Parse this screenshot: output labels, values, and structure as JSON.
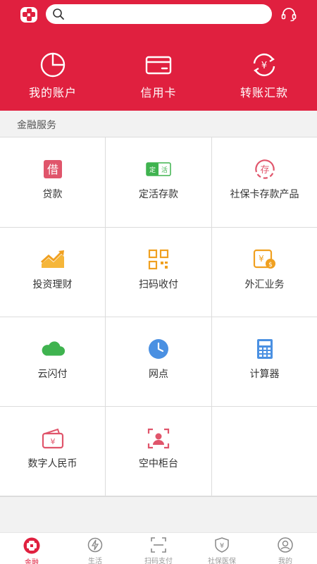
{
  "header": {
    "logo": "bank-logo-icon",
    "search": {
      "placeholder": "",
      "value": ""
    },
    "support_icon": "headset-icon",
    "quick_actions": [
      {
        "label": "我的账户",
        "icon": "pie-chart-icon"
      },
      {
        "label": "信用卡",
        "icon": "credit-card-icon"
      },
      {
        "label": "转账汇款",
        "icon": "transfer-yuan-icon"
      }
    ]
  },
  "section": {
    "title": "金融服务"
  },
  "services": [
    {
      "label": "贷款",
      "icon": "loan-icon",
      "badge": "借"
    },
    {
      "label": "定活存款",
      "icon": "deposit-icon",
      "badge": "定活"
    },
    {
      "label": "社保卡存款产品",
      "icon": "social-card-deposit-icon",
      "badge": "存"
    },
    {
      "label": "投资理财",
      "icon": "investment-icon"
    },
    {
      "label": "扫码收付",
      "icon": "qr-code-icon"
    },
    {
      "label": "外汇业务",
      "icon": "forex-icon"
    },
    {
      "label": "云闪付",
      "icon": "cloud-icon"
    },
    {
      "label": "网点",
      "icon": "clock-icon"
    },
    {
      "label": "计算器",
      "icon": "calculator-icon"
    },
    {
      "label": "数字人民币",
      "icon": "digital-yuan-wallet-icon"
    },
    {
      "label": "空中柜台",
      "icon": "video-counter-icon"
    }
  ],
  "tabbar": [
    {
      "label": "金融",
      "icon": "finance-icon",
      "active": true
    },
    {
      "label": "生活",
      "icon": "life-icon",
      "active": false
    },
    {
      "label": "扫码支付",
      "icon": "scan-icon",
      "active": false
    },
    {
      "label": "社保医保",
      "icon": "insurance-icon",
      "active": false
    },
    {
      "label": "我的",
      "icon": "profile-icon",
      "active": false
    }
  ],
  "colors": {
    "brand": "#e0203f",
    "green": "#3fb34f",
    "orange": "#f0a020",
    "blue": "#4a90e2"
  }
}
